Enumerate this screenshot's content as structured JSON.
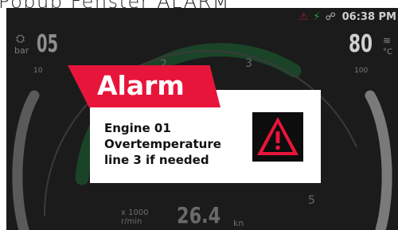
{
  "page_title": "Popup Fenster ALARM",
  "status_bar": {
    "icons": [
      "warning-icon",
      "bolt-icon",
      "link-icon"
    ],
    "time": "06:38 PM"
  },
  "dashboard": {
    "pressure": {
      "value": "05",
      "unit": "bar",
      "scale_max": "10"
    },
    "temperature": {
      "value": "80",
      "unit": "°C",
      "scale_max": "100"
    },
    "rpm": {
      "scale_labels": [
        "2",
        "3",
        "5"
      ],
      "unit_line1": "x 1000",
      "unit_line2": "r/min"
    },
    "speed": {
      "value": "26.4",
      "unit": "kn"
    }
  },
  "popup": {
    "title": "Alarm",
    "message_lines": [
      "Engine 01",
      "Overtemperature",
      "line 3 if needed"
    ],
    "icon": "warning-triangle-icon",
    "colors": {
      "banner": "#e8153b",
      "body": "#ffffff",
      "icon_bg": "#0d0d0d"
    }
  }
}
